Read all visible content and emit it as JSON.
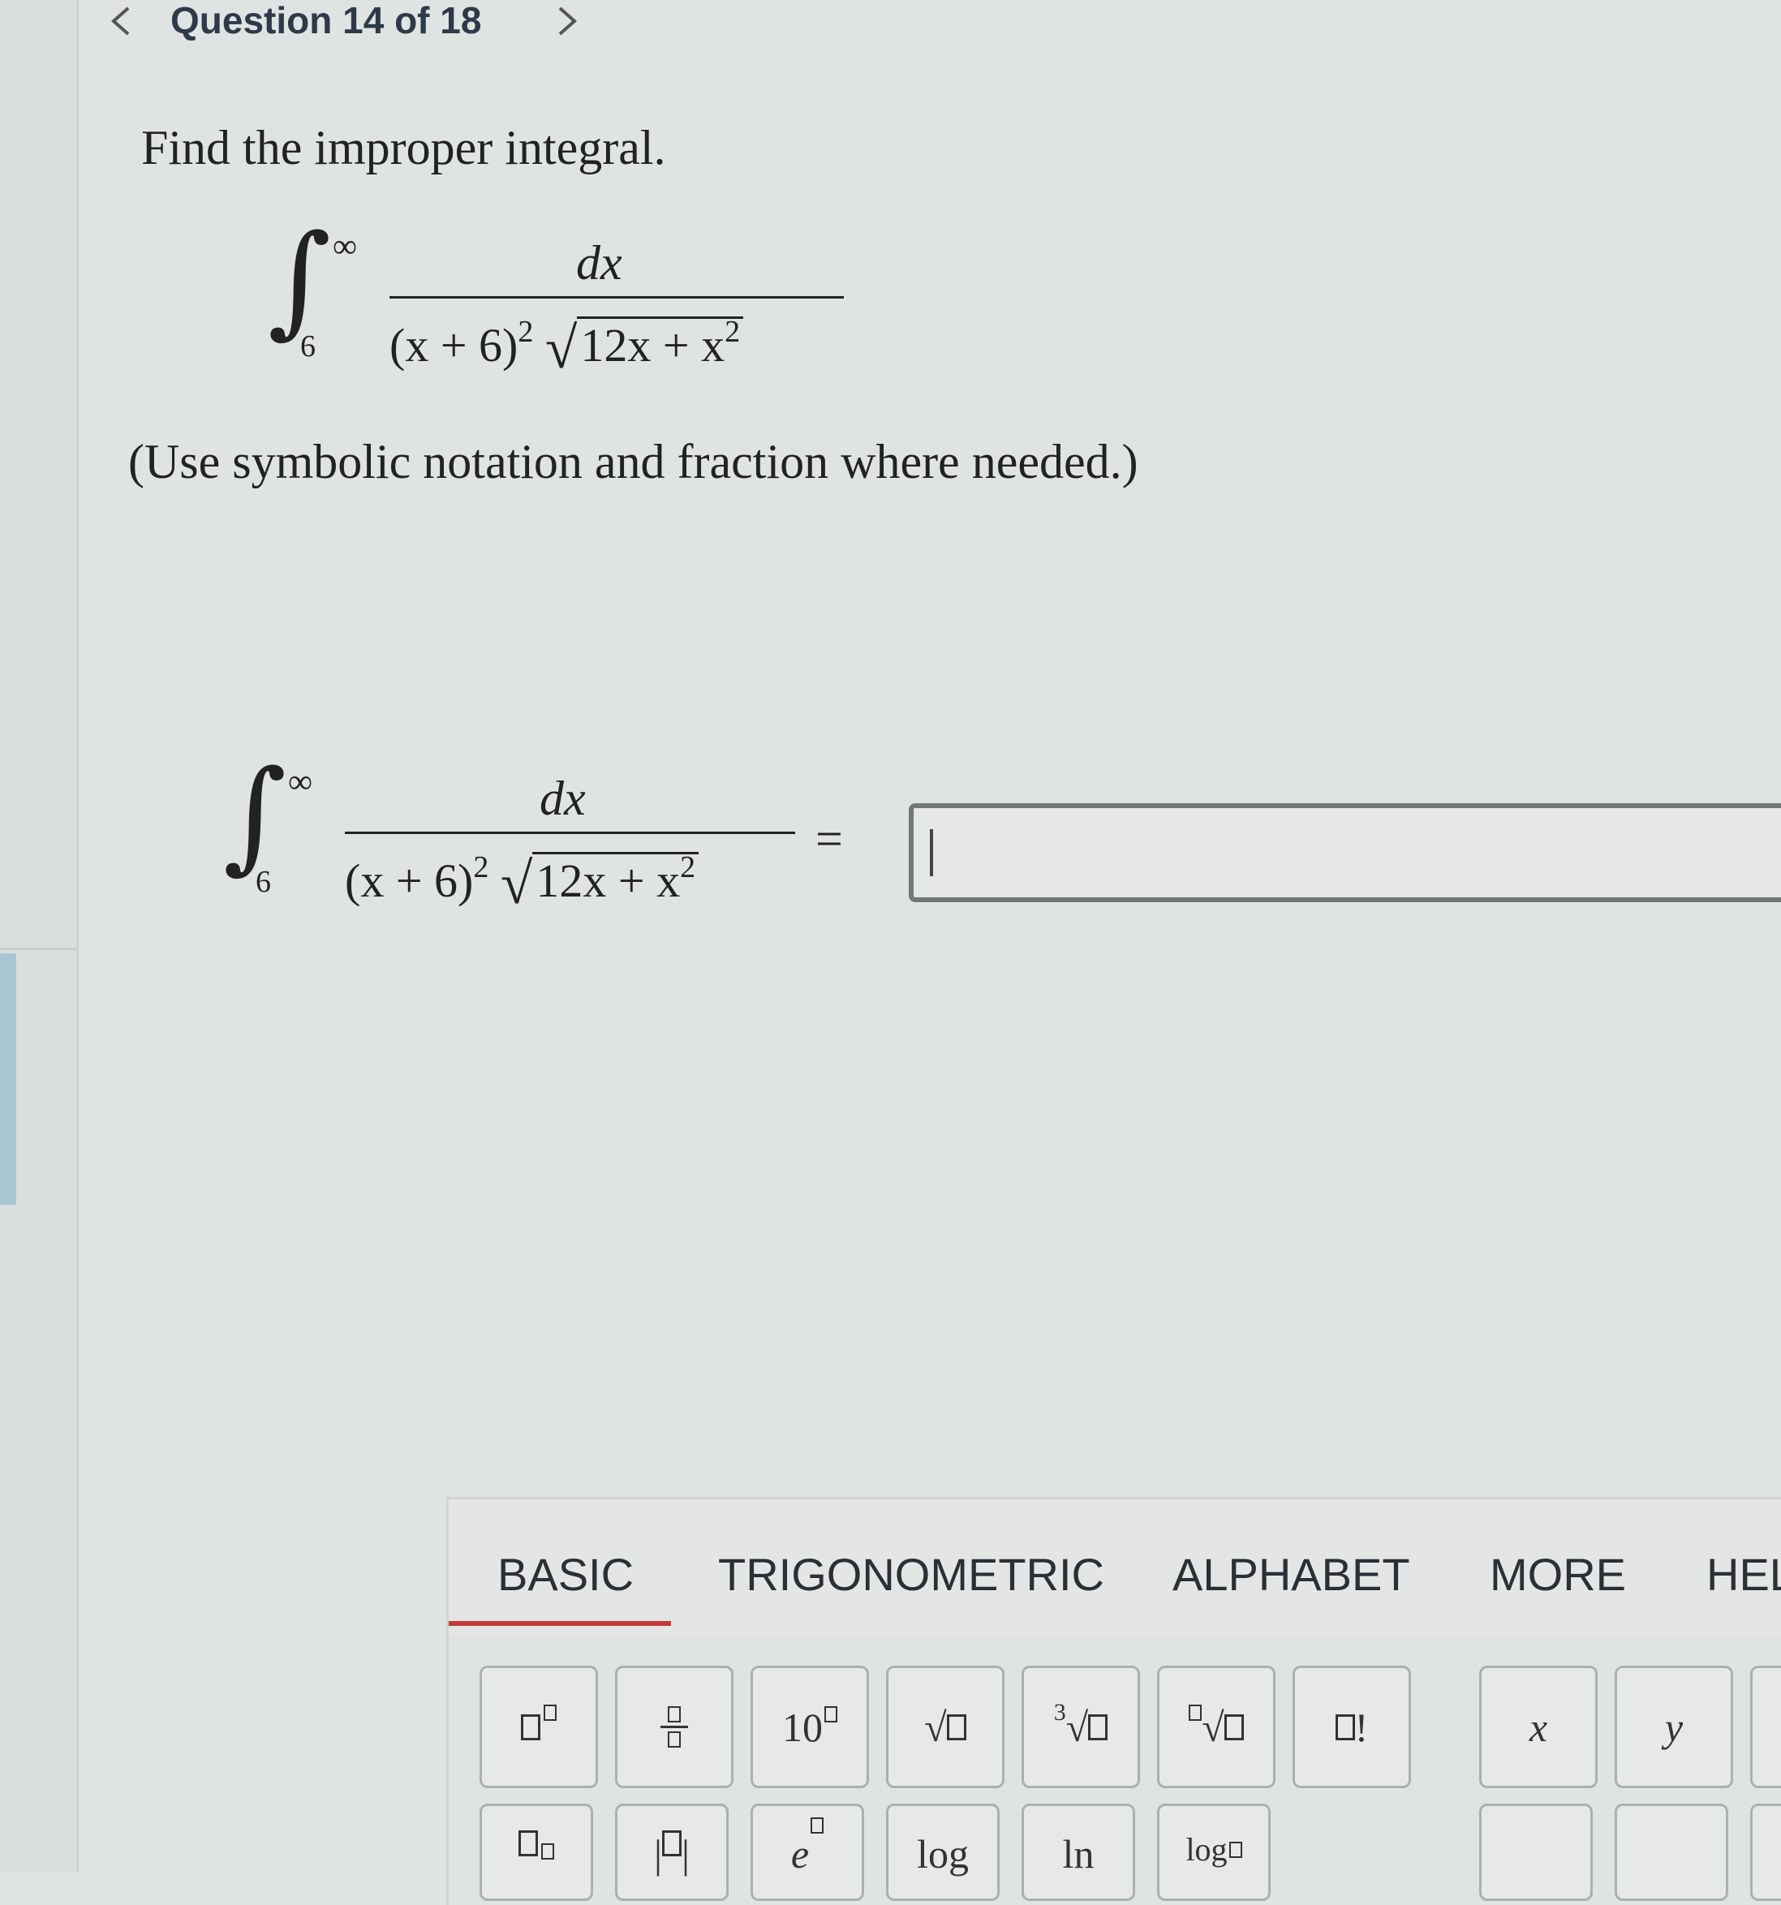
{
  "nav": {
    "title": "Question 14 of 18"
  },
  "question": {
    "prompt": "Find the improper integral.",
    "note": "(Use symbolic notation and fraction where needed.)",
    "integral": {
      "upper": "∞",
      "lower": "6",
      "numerator": "dx",
      "den_base": "(x + 6)",
      "den_exp": "2",
      "radicand_a": "12x + x",
      "radicand_exp": "2"
    },
    "equals": "="
  },
  "answer": {
    "value": ""
  },
  "keypad": {
    "tabs": [
      "BASIC",
      "TRIGONOMETRIC",
      "ALPHABET",
      "MORE",
      "HEL"
    ],
    "active_tab": "BASIC",
    "keys_row1": {
      "k3": "10",
      "k6_index": "3",
      "k8": "!",
      "k9": "x",
      "k10": "y"
    },
    "keys_row2": {
      "k3": "e",
      "k4": "log",
      "k5": "ln",
      "k6": "log"
    },
    "colors": {
      "active_tab_underline": "#c33a3a"
    }
  }
}
